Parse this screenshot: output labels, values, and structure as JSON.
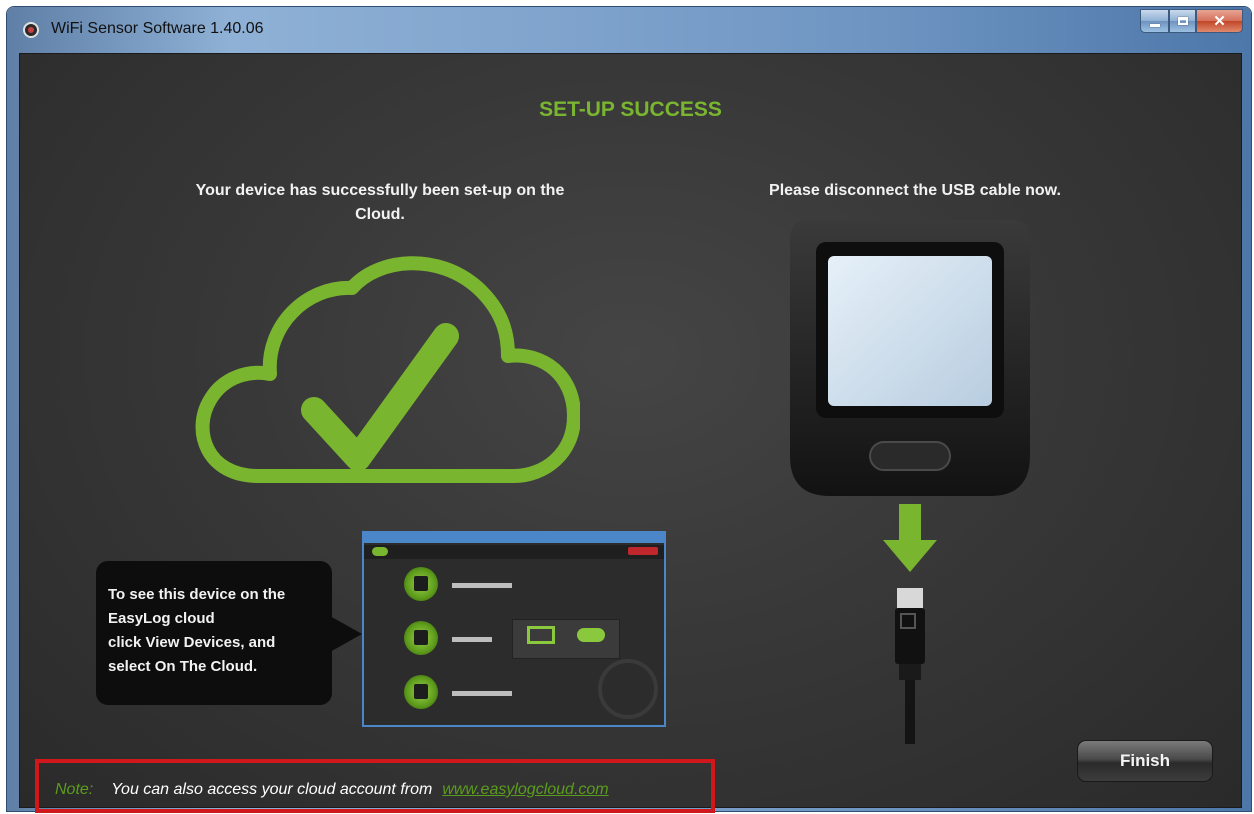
{
  "window": {
    "title": "WiFi Sensor Software 1.40.06",
    "controls": {
      "minimize": "minimize",
      "maximize": "maximize",
      "close": "✕"
    }
  },
  "page": {
    "heading": "SET-UP SUCCESS",
    "left_message": "Your device has successfully been set-up on the Cloud.",
    "right_message": "Please disconnect the USB cable now."
  },
  "callout": {
    "text": "To see this device on the\nEasyLog cloud\nclick View Devices, and\nselect On The Cloud."
  },
  "buttons": {
    "finish": "Finish"
  },
  "note": {
    "label": "Note:",
    "text": "You can also access your cloud account from",
    "link": "www.easylogcloud.com"
  },
  "colors": {
    "accent_green": "#7ab530",
    "note_border": "#d0181c",
    "panel_bg": "#383838"
  },
  "icons": {
    "cloud": "cloud-check-icon",
    "device": "sensor-device-icon",
    "arrow": "arrow-down-icon",
    "usb": "usb-cable-icon"
  }
}
